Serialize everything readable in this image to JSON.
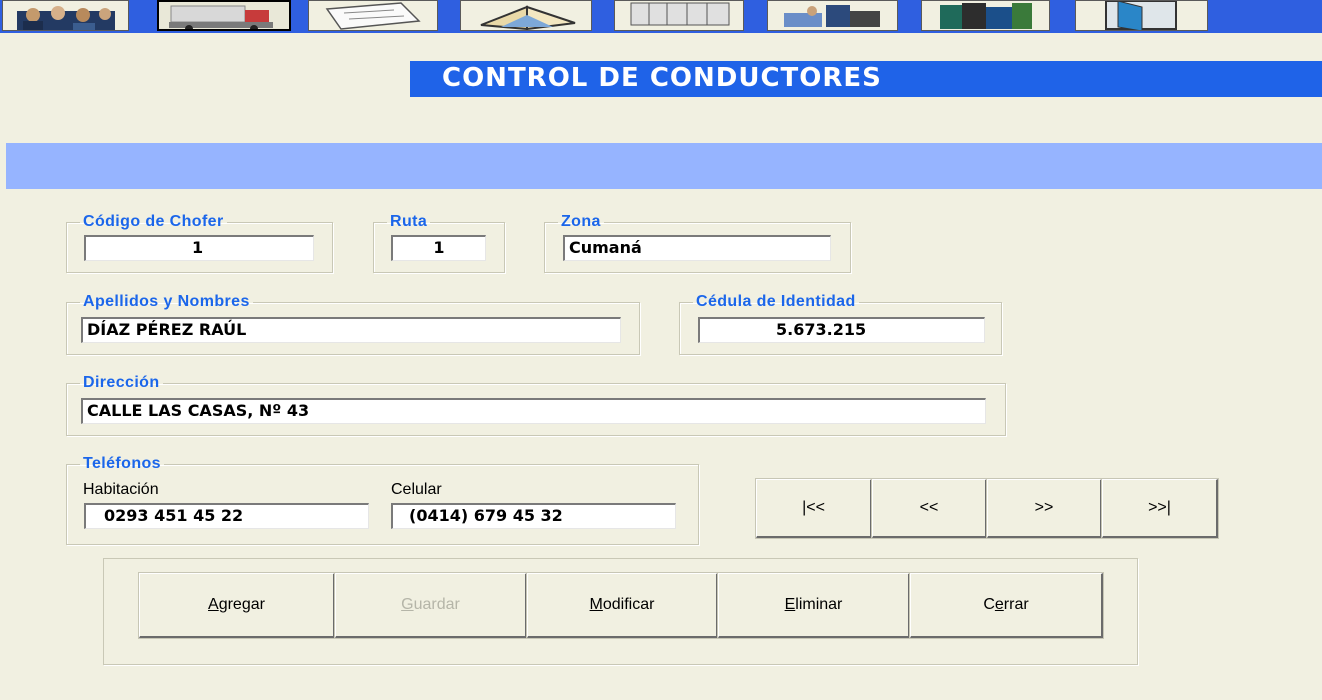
{
  "toolbar": {
    "icons": [
      "people-icon",
      "truck-icon",
      "document-icon",
      "open-book-icon",
      "books-icon",
      "handshake-icon",
      "library-icon",
      "door-icon"
    ],
    "pressed_index": 1
  },
  "header": {
    "title": "CONTROL DE CONDUCTORES"
  },
  "form": {
    "codigo": {
      "legend": "Código de Chofer",
      "value": "1"
    },
    "ruta": {
      "legend": "Ruta",
      "value": "1"
    },
    "zona": {
      "legend": "Zona",
      "value": "Cumaná"
    },
    "nombres": {
      "legend": "Apellidos y Nombres",
      "value": "DÍAZ PÉREZ RAÚL"
    },
    "cedula": {
      "legend": "Cédula de Identidad",
      "value": "5.673.215"
    },
    "direccion": {
      "legend": "Dirección",
      "value": "CALLE LAS CASAS, Nº 43"
    },
    "telefonos": {
      "legend": "Teléfonos",
      "habitacion_label": "Habitación",
      "habitacion_value": "0293 451 45 22",
      "celular_label": "Celular",
      "celular_value": "(0414) 679 45 32"
    }
  },
  "navigation": {
    "first": "|<<",
    "prev": "<<",
    "next": ">>",
    "last": ">>|"
  },
  "actions": {
    "agregar": {
      "mnemonic": "A",
      "rest": "gregar"
    },
    "guardar": {
      "mnemonic": "G",
      "rest": "uardar",
      "disabled": true
    },
    "modificar": {
      "mnemonic": "M",
      "rest": "odificar"
    },
    "eliminar": {
      "mnemonic": "E",
      "rest": "liminar"
    },
    "cerrar": {
      "pre": "C",
      "mnemonic": "e",
      "rest": "rrar"
    }
  },
  "colors": {
    "toolbar_blue": "#2f5fe0",
    "title_blue": "#1f63e8",
    "band_blue": "#96b4ff",
    "legend_blue": "#1b66ea",
    "form_bg": "#f1f0e1"
  }
}
